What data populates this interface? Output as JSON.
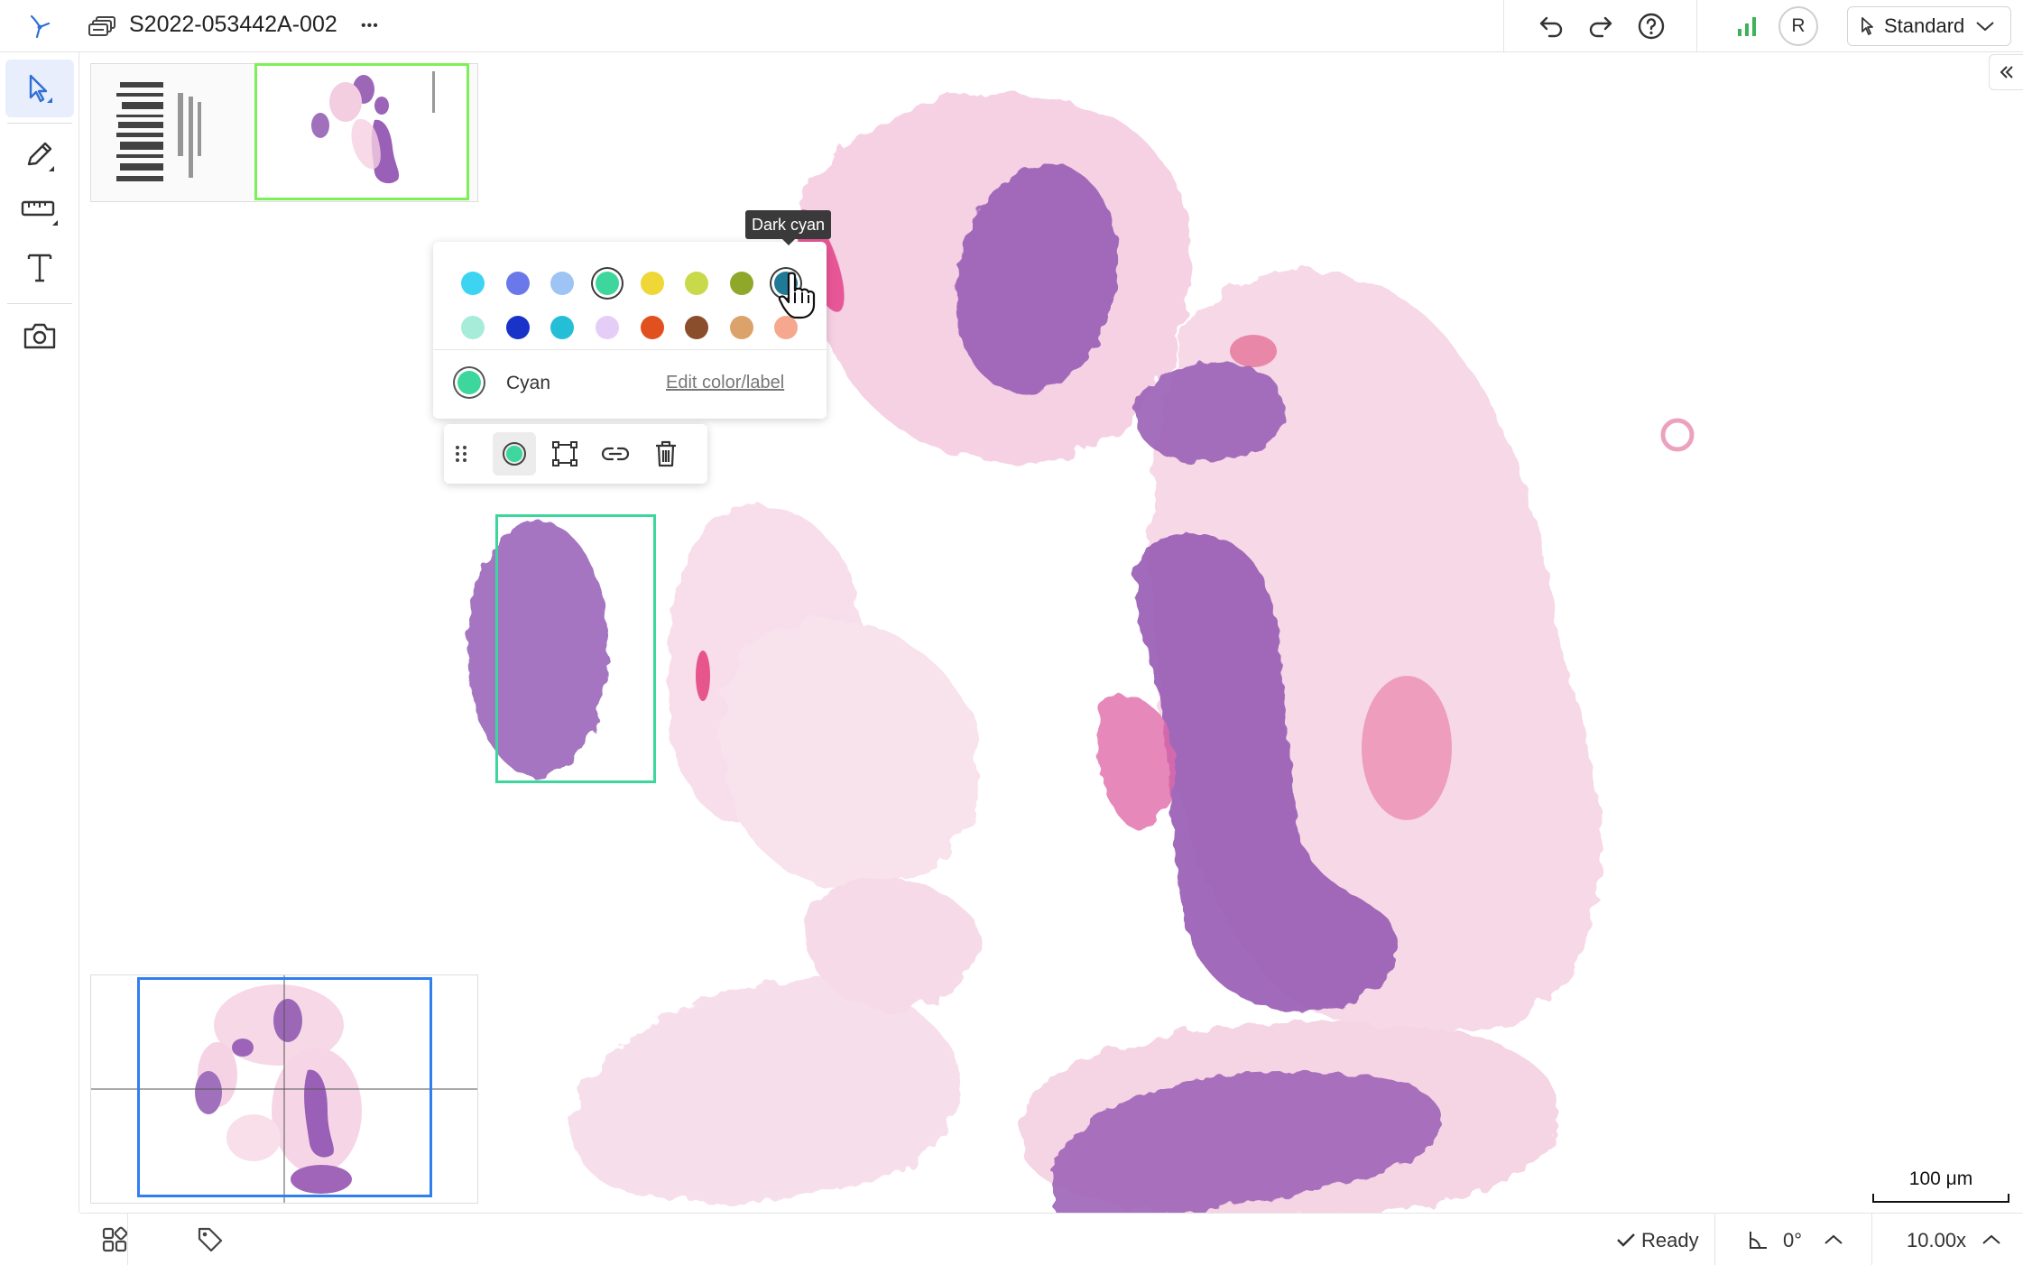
{
  "header": {
    "slide_id": "S2022-053442A-002",
    "more_glyph": "•••",
    "avatar_initial": "R",
    "mode_label": "Standard"
  },
  "color_picker": {
    "tooltip": "Dark cyan",
    "swatches_row1": [
      "#3cd4f0",
      "#6a78ea",
      "#9ec3f5",
      "#3dd69c",
      "#eed736",
      "#c8d94a",
      "#8fa82a",
      "#1f7a96"
    ],
    "swatches_row2": [
      "#a7ecd9",
      "#1932c8",
      "#24bfd6",
      "#e4cef7",
      "#e1501f",
      "#8a4e2c",
      "#dba36b",
      "#f5a88d"
    ],
    "selected_index": 3,
    "hovered_index": 7,
    "current_color": "#3dd69c",
    "current_name": "Cyan",
    "edit_link": "Edit color/label"
  },
  "annotation": {
    "stroke_color": "#3dd69c"
  },
  "scale_bar": {
    "label": "100 μm"
  },
  "footer": {
    "status": "Ready",
    "rotation": "0°",
    "zoom": "10.00x"
  },
  "colors": {
    "accent": "#2f6fd6",
    "thumb_highlight": "#7cf057",
    "overview_box": "#2f7ff0",
    "signal_icon": "#3db25a"
  }
}
